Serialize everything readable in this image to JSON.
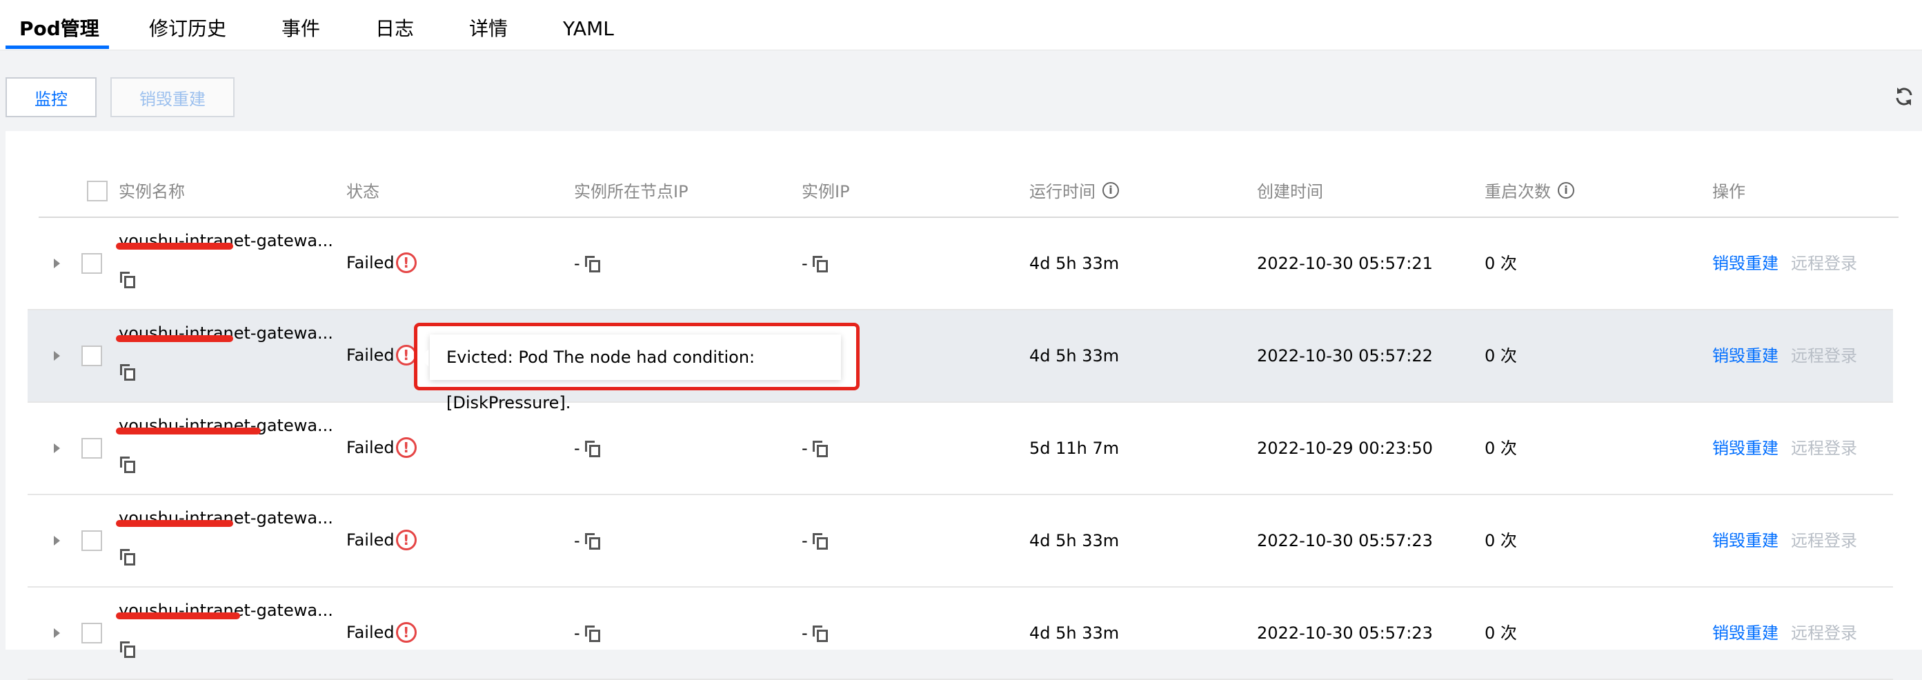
{
  "tabs": [
    {
      "label": "Pod管理",
      "active": true
    },
    {
      "label": "修订历史"
    },
    {
      "label": "事件"
    },
    {
      "label": "日志"
    },
    {
      "label": "详情"
    },
    {
      "label": "YAML"
    }
  ],
  "toolbar": {
    "monitor_label": "监控",
    "destroy_label": "销毁重建",
    "refresh_icon": "refresh-icon"
  },
  "table": {
    "headers": {
      "name": "实例名称",
      "status": "状态",
      "node_ip": "实例所在节点IP",
      "pod_ip": "实例IP",
      "uptime": "运行时间",
      "created": "创建时间",
      "restarts": "重启次数",
      "actions": "操作"
    },
    "rows": [
      {
        "name": "youshu-intranet-gatewa...",
        "status": "Failed",
        "node_ip": "-",
        "pod_ip": "-",
        "uptime": "4d 5h 33m",
        "created": "2022-10-30 05:57:21",
        "restarts": "0 次",
        "action1": "销毁重建",
        "action2": "远程登录"
      },
      {
        "name": "youshu-intranet-gatewa...",
        "status": "Failed",
        "node_ip": "-",
        "pod_ip": "-",
        "uptime": "4d 5h 33m",
        "created": "2022-10-30 05:57:22",
        "restarts": "0 次",
        "action1": "销毁重建",
        "action2": "远程登录"
      },
      {
        "name": "youshu-intranet-gatewa...",
        "status": "Failed",
        "node_ip": "-",
        "pod_ip": "-",
        "uptime": "5d 11h 7m",
        "created": "2022-10-29 00:23:50",
        "restarts": "0 次",
        "action1": "销毁重建",
        "action2": "远程登录"
      },
      {
        "name": "youshu-intranet-gatewa...",
        "status": "Failed",
        "node_ip": "-",
        "pod_ip": "-",
        "uptime": "4d 5h 33m",
        "created": "2022-10-30 05:57:23",
        "restarts": "0 次",
        "action1": "销毁重建",
        "action2": "远程登录"
      },
      {
        "name": "youshu-intranet-gatewa...",
        "status": "Failed",
        "node_ip": "-",
        "pod_ip": "-",
        "uptime": "4d 5h 33m",
        "created": "2022-10-30 05:57:23",
        "restarts": "0 次",
        "action1": "销毁重建",
        "action2": "远程登录"
      }
    ]
  },
  "tooltip": {
    "text": "Evicted: Pod The node had condition: [DiskPressure]."
  },
  "colors": {
    "accent": "#006eff",
    "error": "#e54545",
    "highlight_row": "#e9ecf0",
    "annotation": "#e5231b"
  }
}
